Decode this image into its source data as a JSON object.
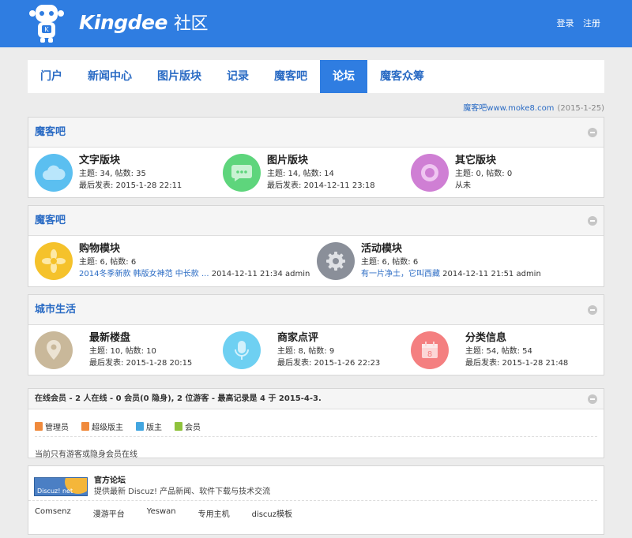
{
  "header": {
    "brand": "Kingdee",
    "brand_cn": "社区",
    "login": "登录",
    "register": "注册"
  },
  "nav": [
    {
      "label": "门户"
    },
    {
      "label": "新闻中心"
    },
    {
      "label": "图片版块"
    },
    {
      "label": "记录"
    },
    {
      "label": "魔客吧"
    },
    {
      "label": "论坛",
      "active": true
    },
    {
      "label": "魔客众筹"
    }
  ],
  "notice": {
    "text": "魔客吧www.moke8.com",
    "date": "(2015-1-25)"
  },
  "sections": [
    {
      "title": "魔客吧",
      "forums": [
        {
          "name": "文字版块",
          "stats": "主题: 34, 帖数: 35",
          "last": "最后发表: 2015-1-28 22:11",
          "icon": "cloud-icon",
          "color": "#5bbff0"
        },
        {
          "name": "图片版块",
          "stats": "主题: 14, 帖数: 14",
          "last": "最后发表: 2014-12-11 23:18",
          "icon": "chat-bubble-icon",
          "color": "#5ed57c"
        },
        {
          "name": "其它版块",
          "stats": "主题: 0, 帖数: 0",
          "last": "从未",
          "icon": "ring-icon",
          "color": "#cf7fd4"
        }
      ]
    },
    {
      "title": "魔客吧",
      "forums": [
        {
          "name": "购物模块",
          "stats": "主题: 6, 帖数: 6",
          "last_link": "2014冬季新款 韩版女神范 中长款 ...",
          "last_rest": " 2014-12-11 21:34 admin",
          "icon": "flower-icon",
          "color": "#f5c22b"
        },
        {
          "name": "活动模块",
          "stats": "主题: 6, 帖数: 6",
          "last_link": "有一片净土，它叫西藏",
          "last_rest": " 2014-12-11 21:51 admin",
          "icon": "gear-icon",
          "color": "#8a8f99"
        }
      ]
    },
    {
      "title": "城市生活",
      "forums": [
        {
          "name": "最新楼盘",
          "stats": "主题: 10, 帖数: 10",
          "last": "最后发表: 2015-1-28 20:15",
          "icon": "location-pin-icon",
          "color": "#c9b89a"
        },
        {
          "name": "商家点评",
          "stats": "主题: 8, 帖数: 9",
          "last": "最后发表: 2015-1-26 22:23",
          "icon": "microphone-icon",
          "color": "#6ed0f2"
        },
        {
          "name": "分类信息",
          "stats": "主题: 54, 帖数: 54",
          "last": "最后发表: 2015-1-28 21:48",
          "icon": "calendar-icon",
          "color": "#f47f80"
        }
      ]
    }
  ],
  "online": {
    "title": "在线会员 - 2 人在线 - 0 会员(0 隐身), 2 位游客 - 最高记录是 4 于 2015-4-3.",
    "legend": [
      {
        "label": "管理员",
        "color": "#f08a3c"
      },
      {
        "label": "超级版主",
        "color": "#f08a3c"
      },
      {
        "label": "版主",
        "color": "#43a6e0"
      },
      {
        "label": "会员",
        "color": "#8fc23c"
      }
    ],
    "message": "当前只有游客或隐身会员在线"
  },
  "official": {
    "badge": "Discuz! net",
    "title": "官方论坛",
    "desc": "提供最新 Discuz! 产品新闻、软件下载与技术交流",
    "links": [
      "Comsenz",
      "漫游平台",
      "Yeswan",
      "专用主机",
      "discuz模板"
    ]
  }
}
